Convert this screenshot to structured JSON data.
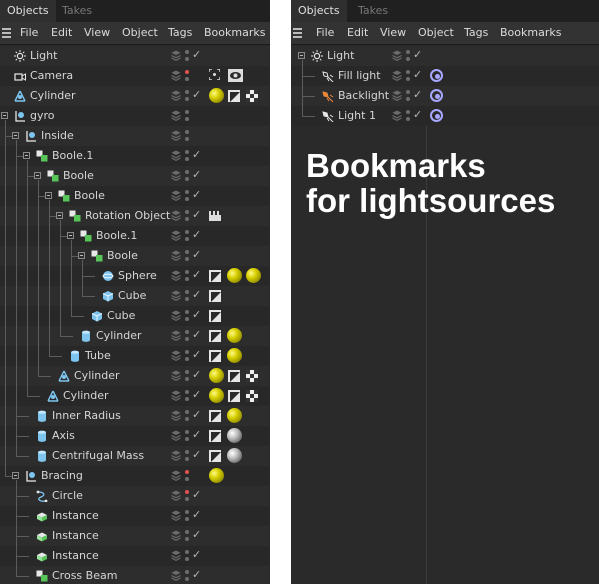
{
  "colors": {
    "panel_bg": "#2a2a2a",
    "row_even": "#2d2d2d",
    "row_odd": "#282828",
    "menubar_bg": "#333333",
    "text": "#d6d6d6",
    "dot_red": "#e25050",
    "ball_yellow": "#d7d000",
    "target_purple": "#a7a7ff",
    "light_blue_icon": "#7dc4ef",
    "green_icon": "#57c557"
  },
  "left": {
    "tabs": [
      "Objects",
      "Takes"
    ],
    "menu": [
      "File",
      "Edit",
      "View",
      "Object",
      "Tags",
      "Bookmarks"
    ],
    "rows": [
      {
        "label": "Light",
        "icon": "light-bulb-icon",
        "depth": 0,
        "check": true,
        "dot": "gray",
        "tags": []
      },
      {
        "label": "Camera",
        "icon": "camera-icon",
        "depth": 0,
        "check": false,
        "dot": "red",
        "tags": [
          "viewfinder-icon",
          "eye-icon"
        ]
      },
      {
        "label": "Cylinder",
        "icon": "primitive-tripod-icon",
        "depth": 0,
        "check": true,
        "dot": "gray",
        "tags": [
          "yellow-material-ball",
          "phong-tag-icon",
          "texture-checker-icon"
        ]
      },
      {
        "label": "gyro",
        "icon": "null-object-icon",
        "depth": 0,
        "check": false,
        "dot": "gray",
        "tags": []
      },
      {
        "label": "Inside",
        "icon": "null-object-icon",
        "depth": 1,
        "check": false,
        "dot": "gray",
        "tags": []
      },
      {
        "label": "Boole.1",
        "icon": "boole-icon",
        "depth": 2,
        "check": true,
        "dot": "gray",
        "tags": []
      },
      {
        "label": "Boole",
        "icon": "boole-icon",
        "depth": 3,
        "check": true,
        "dot": "gray",
        "tags": []
      },
      {
        "label": "Boole",
        "icon": "boole-icon",
        "depth": 4,
        "check": true,
        "dot": "gray",
        "tags": []
      },
      {
        "label": "Rotation Object",
        "icon": "boole-icon",
        "depth": 5,
        "check": true,
        "dot": "gray",
        "tags": [
          "clapper-icon"
        ]
      },
      {
        "label": "Boole.1",
        "icon": "boole-icon",
        "depth": 6,
        "check": true,
        "dot": "gray",
        "tags": []
      },
      {
        "label": "Boole",
        "icon": "boole-icon",
        "depth": 7,
        "check": true,
        "dot": "gray",
        "tags": []
      },
      {
        "label": "Sphere",
        "icon": "sphere-icon",
        "depth": 8,
        "check": true,
        "dot": "gray",
        "tags": [
          "phong-tag-icon",
          "yellow-material-ball",
          "yellow-material-ball"
        ]
      },
      {
        "label": "Cube",
        "icon": "cube-icon",
        "depth": 8,
        "check": true,
        "dot": "gray",
        "tags": [
          "phong-tag-icon"
        ]
      },
      {
        "label": "Cube",
        "icon": "cube-icon",
        "depth": 7,
        "check": true,
        "dot": "gray",
        "tags": [
          "phong-tag-icon"
        ]
      },
      {
        "label": "Cylinder",
        "icon": "cylinder-icon",
        "depth": 6,
        "check": true,
        "dot": "gray",
        "tags": [
          "phong-tag-icon",
          "yellow-material-ball"
        ]
      },
      {
        "label": "Tube",
        "icon": "cylinder-icon",
        "depth": 5,
        "check": true,
        "dot": "gray",
        "tags": [
          "phong-tag-icon",
          "yellow-material-ball"
        ]
      },
      {
        "label": "Cylinder",
        "icon": "primitive-tripod-icon",
        "depth": 4,
        "check": true,
        "dot": "gray",
        "tags": [
          "yellow-material-ball",
          "phong-tag-icon",
          "texture-checker-icon"
        ]
      },
      {
        "label": "Cylinder",
        "icon": "primitive-tripod-icon",
        "depth": 3,
        "check": true,
        "dot": "gray",
        "tags": [
          "yellow-material-ball",
          "phong-tag-icon",
          "texture-checker-icon"
        ]
      },
      {
        "label": "Inner Radius",
        "icon": "cylinder-icon",
        "depth": 2,
        "check": true,
        "dot": "gray",
        "tags": [
          "phong-tag-icon",
          "yellow-material-ball"
        ]
      },
      {
        "label": "Axis",
        "icon": "cylinder-icon",
        "depth": 2,
        "check": true,
        "dot": "gray",
        "tags": [
          "phong-tag-icon",
          "chrome-material-ball"
        ]
      },
      {
        "label": "Centrifugal Mass",
        "icon": "cylinder-icon",
        "depth": 2,
        "check": true,
        "dot": "gray",
        "tags": [
          "phong-tag-icon",
          "chrome-material-ball"
        ]
      },
      {
        "label": "Bracing",
        "icon": "null-object-icon",
        "depth": 1,
        "check": false,
        "dot": "red",
        "tags": [
          "yellow-material-ball"
        ]
      },
      {
        "label": "Circle",
        "icon": "spline-circle-icon",
        "depth": 2,
        "check": true,
        "dot": "red",
        "tags": []
      },
      {
        "label": "Instance",
        "icon": "instance-icon",
        "depth": 2,
        "check": true,
        "dot": "gray",
        "tags": []
      },
      {
        "label": "Instance",
        "icon": "instance-icon",
        "depth": 2,
        "check": true,
        "dot": "gray",
        "tags": []
      },
      {
        "label": "Instance",
        "icon": "instance-icon",
        "depth": 2,
        "check": true,
        "dot": "gray",
        "tags": []
      },
      {
        "label": "Cross Beam",
        "icon": "boole-icon",
        "depth": 2,
        "check": true,
        "dot": "gray",
        "tags": []
      }
    ]
  },
  "right": {
    "tabs": [
      "Objects",
      "Takes"
    ],
    "menu": [
      "File",
      "Edit",
      "View",
      "Object",
      "Tags",
      "Bookmarks"
    ],
    "rows": [
      {
        "label": "Light",
        "icon": "light-bulb-icon",
        "depth": 0,
        "check": true,
        "dot": "gray",
        "tags": []
      },
      {
        "label": "Fill light",
        "icon": "spot-light-icon",
        "depth": 1,
        "check": true,
        "dot": "gray",
        "tags": [
          "bookmark-target-icon"
        ]
      },
      {
        "label": "Backlight",
        "icon": "spot-light-orange-icon",
        "depth": 1,
        "check": true,
        "dot": "gray",
        "tags": [
          "bookmark-target-icon"
        ]
      },
      {
        "label": "Light 1",
        "icon": "spot-light-white-icon",
        "depth": 1,
        "check": true,
        "dot": "gray",
        "tags": [
          "bookmark-target-icon"
        ]
      }
    ],
    "caption": [
      "Bookmarks",
      "for lightsources"
    ]
  }
}
